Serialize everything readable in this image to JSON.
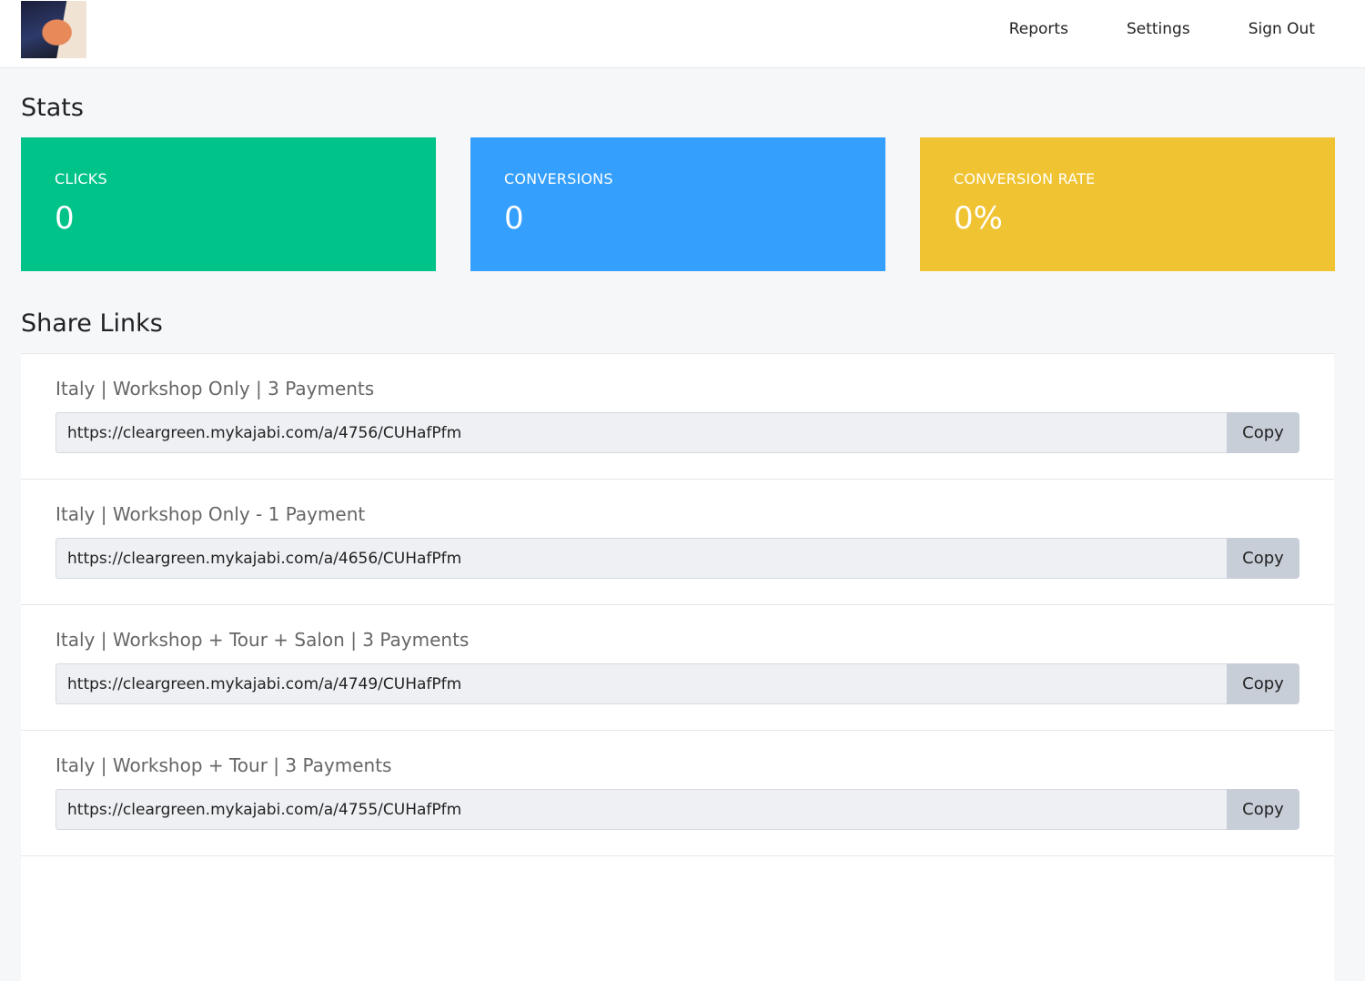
{
  "nav": {
    "reports": "Reports",
    "settings": "Settings",
    "sign_out": "Sign Out"
  },
  "stats": {
    "title": "Stats",
    "cards": [
      {
        "label": "CLICKS",
        "value": "0",
        "color": "#00c389"
      },
      {
        "label": "CONVERSIONS",
        "value": "0",
        "color": "#359ffd"
      },
      {
        "label": "CONVERSION RATE",
        "value": "0%",
        "color": "#f0c332"
      }
    ]
  },
  "share": {
    "title": "Share Links",
    "copy_label": "Copy",
    "links": [
      {
        "title": "Italy | Workshop Only | 3 Payments",
        "url": "https://cleargreen.mykajabi.com/a/4756/CUHafPfm"
      },
      {
        "title": "Italy | Workshop Only - 1 Payment",
        "url": "https://cleargreen.mykajabi.com/a/4656/CUHafPfm"
      },
      {
        "title": "Italy | Workshop + Tour + Salon | 3 Payments",
        "url": "https://cleargreen.mykajabi.com/a/4749/CUHafPfm"
      },
      {
        "title": "Italy | Workshop + Tour | 3 Payments",
        "url": "https://cleargreen.mykajabi.com/a/4755/CUHafPfm"
      }
    ]
  }
}
